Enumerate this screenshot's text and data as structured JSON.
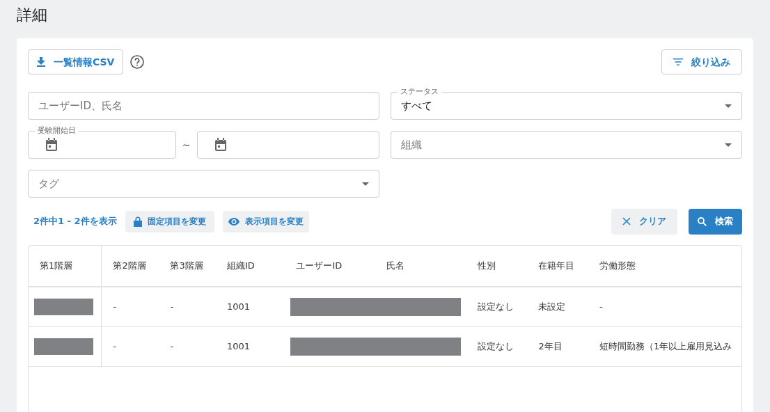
{
  "page_title": "詳細",
  "toolbar": {
    "csv_button": "一覧情報CSV",
    "filter_button": "絞り込み"
  },
  "filters": {
    "keyword": {
      "placeholder": "ユーザーID、氏名"
    },
    "status": {
      "label": "ステータス",
      "value": "すべて"
    },
    "exam_start_date": {
      "label": "受験開始日",
      "separator": "～"
    },
    "organization": {
      "placeholder": "組織"
    },
    "tag": {
      "placeholder": "タグ"
    }
  },
  "result_bar": {
    "count": "2件中1 - 2件を表示",
    "fixed_columns_button": "固定項目を変更",
    "visible_columns_button": "表示項目を変更",
    "clear_button": "クリア",
    "search_button": "検索"
  },
  "table": {
    "columns": [
      "第1階層",
      "第2階層",
      "第3階層",
      "組織ID",
      "ユーザーID",
      "氏名",
      "性別",
      "在籍年目",
      "労働形態"
    ],
    "rows": [
      {
        "cells": [
          {
            "kind": "redacted"
          },
          {
            "kind": "text",
            "text": "-"
          },
          {
            "kind": "text",
            "text": "-"
          },
          {
            "kind": "text",
            "text": "1001"
          },
          {
            "kind": "redacted_fill"
          },
          {
            "kind": "redacted_fill"
          },
          {
            "kind": "text",
            "text": "設定なし"
          },
          {
            "kind": "text",
            "text": "未設定"
          },
          {
            "kind": "text",
            "text": "-"
          }
        ]
      },
      {
        "cells": [
          {
            "kind": "redacted"
          },
          {
            "kind": "text",
            "text": "-"
          },
          {
            "kind": "text",
            "text": "-"
          },
          {
            "kind": "text",
            "text": "1001"
          },
          {
            "kind": "redacted_fill"
          },
          {
            "kind": "redacted_fill"
          },
          {
            "kind": "text",
            "text": "設定なし"
          },
          {
            "kind": "text",
            "text": "2年目"
          },
          {
            "kind": "text",
            "text": "短時間勤務（1年以上雇用見込み"
          }
        ]
      }
    ]
  }
}
